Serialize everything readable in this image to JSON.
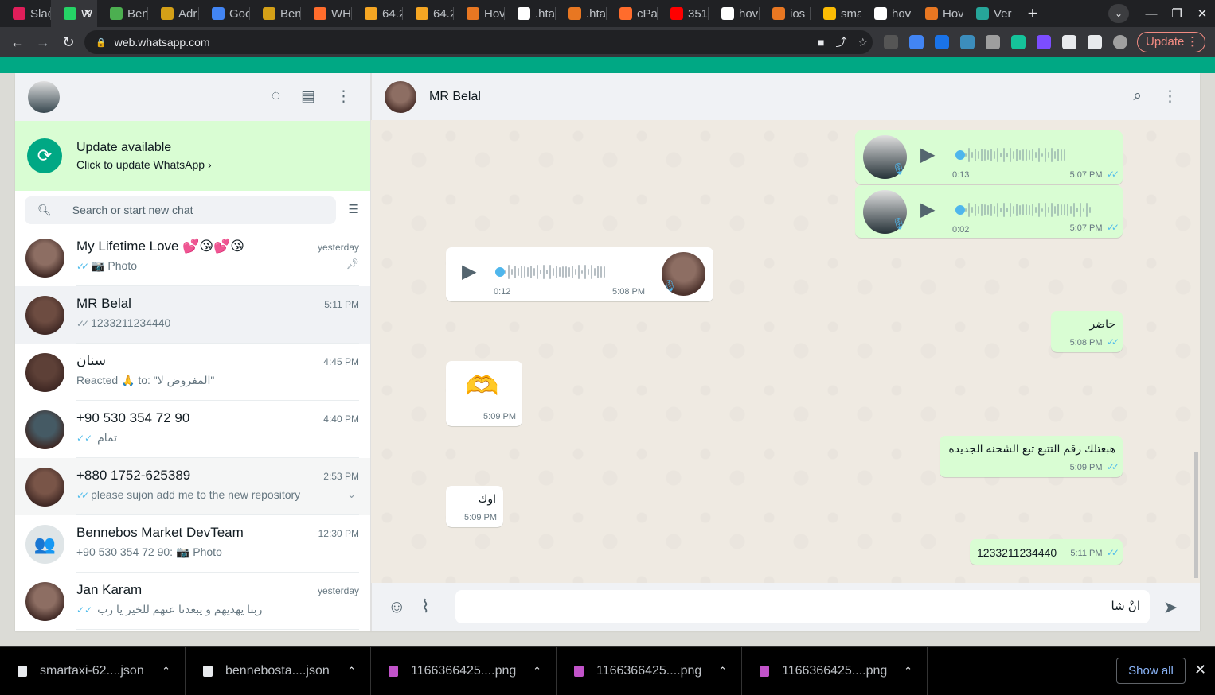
{
  "browser": {
    "tabs": [
      {
        "label": "Slac",
        "color": "#e01e5a"
      },
      {
        "label": "W",
        "color": "#25d366",
        "active": true
      },
      {
        "label": "Ben",
        "color": "#4caf50"
      },
      {
        "label": "Adr",
        "color": "#d4a017"
      },
      {
        "label": "Goc",
        "color": "#4285f4"
      },
      {
        "label": "Ben",
        "color": "#d4a017"
      },
      {
        "label": "WH",
        "color": "#ff6c2c"
      },
      {
        "label": "64.2",
        "color": "#f5a623"
      },
      {
        "label": "64.2",
        "color": "#f5a623"
      },
      {
        "label": "Hov",
        "color": "#e87722"
      },
      {
        "label": ".hta",
        "color": "#ffffff"
      },
      {
        "label": ".hta",
        "color": "#e87722"
      },
      {
        "label": "cPa",
        "color": "#ff6c2c"
      },
      {
        "label": "351)",
        "color": "#ff0000"
      },
      {
        "label": "hov",
        "color": "#ffffff"
      },
      {
        "label": "ios",
        "color": "#e87722"
      },
      {
        "label": "sma",
        "color": "#fbbc04"
      },
      {
        "label": "hov",
        "color": "#ffffff"
      },
      {
        "label": "Hov",
        "color": "#e87722"
      },
      {
        "label": "Ver",
        "color": "#26a69a"
      }
    ],
    "url": "web.whatsapp.com",
    "update_label": "Update",
    "extension_colors": [
      "#555555",
      "#4285f4",
      "#1a73e8",
      "#3c8dbc",
      "#9e9e9e",
      "#15c39a",
      "#7c4dff",
      "#e8eaed",
      "#e8eaed",
      "#a0a0a0"
    ]
  },
  "sidebar": {
    "update": {
      "title": "Update available",
      "subtitle": "Click to update WhatsApp ›"
    },
    "search_placeholder": "Search or start new chat",
    "chats": [
      {
        "name": "My Lifetime Love 💕😘💕😘",
        "time": "yesterday",
        "tick": "✓✓",
        "preview": "📷 Photo",
        "pinned": true,
        "avatar_color": "#8d6e63"
      },
      {
        "name": "MR Belal",
        "time": "5:11 PM",
        "tick": "✓✓",
        "preview": "1233211234440",
        "selected": true,
        "avatar_color": "#6d4c41"
      },
      {
        "name": "سنان",
        "time": "4:45 PM",
        "tick": "",
        "preview": "Reacted 🙏 to: \"المفروض لا\"",
        "avatar_color": "#5d4037"
      },
      {
        "name": "+90 530 354 72 90",
        "time": "4:40 PM",
        "tick": "✓✓",
        "preview": "تمام",
        "avatar_color": "#455a64"
      },
      {
        "name": "+880 1752-625389",
        "time": "2:53 PM",
        "tick": "✓✓",
        "preview": "please sujon add me to the new repository",
        "hover": true,
        "avatar_color": "#795548"
      },
      {
        "name": "Bennebos Market DevTeam",
        "time": "12:30 PM",
        "tick": "",
        "preview": "+90 530 354 72 90: 📷 Photo",
        "group": true,
        "avatar_color": "#dfe5e7"
      },
      {
        "name": "Jan Karam",
        "time": "yesterday",
        "tick": "✓✓",
        "preview": "ربنا يهديهم و يبعدنا عنهم للخير يا رب",
        "avatar_color": "#8d6e63"
      }
    ]
  },
  "conversation": {
    "contact_name": "MR Belal",
    "messages": [
      {
        "type": "voice",
        "dir": "out",
        "duration": "0:13",
        "time": "5:07 PM"
      },
      {
        "type": "voice",
        "dir": "out",
        "duration": "0:02",
        "time": "5:07 PM"
      },
      {
        "type": "voice",
        "dir": "in",
        "duration": "0:12",
        "time": "5:08 PM"
      },
      {
        "type": "text",
        "dir": "out",
        "text": "حاضر",
        "time": "5:08 PM"
      },
      {
        "type": "emoji",
        "dir": "in",
        "text": "🫶",
        "time": "5:09 PM"
      },
      {
        "type": "text",
        "dir": "out",
        "text": "هبعتلك رقم التتبع تبع الشحنه الجديده",
        "time": "5:09 PM"
      },
      {
        "type": "text",
        "dir": "in",
        "text": "اوك",
        "time": "5:09 PM"
      },
      {
        "type": "text",
        "dir": "out",
        "text": "1233211234440",
        "time": "5:11 PM"
      }
    ],
    "composer_value": "انْ شا"
  },
  "downloads": [
    {
      "name": "smartaxi-62....json",
      "kind": "file"
    },
    {
      "name": "bennebosta....json",
      "kind": "file"
    },
    {
      "name": "1166366425....png",
      "kind": "image"
    },
    {
      "name": "1166366425....png",
      "kind": "image"
    },
    {
      "name": "1166366425....png",
      "kind": "image"
    }
  ],
  "show_all_label": "Show all",
  "accent_color": "#00a884"
}
